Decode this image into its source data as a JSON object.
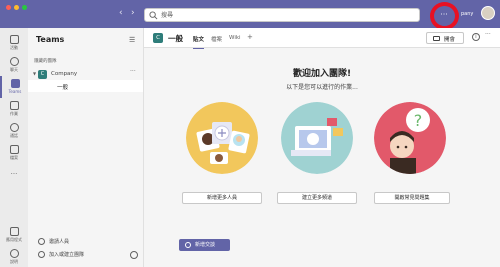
{
  "search": {
    "placeholder": "搜尋"
  },
  "titlebar": {
    "more_label": "···",
    "org_name": "pany"
  },
  "rail": {
    "items": [
      {
        "label": "活動",
        "icon": "bell-icon"
      },
      {
        "label": "聊天",
        "icon": "chat-icon"
      },
      {
        "label": "Teams",
        "icon": "teams-icon"
      },
      {
        "label": "作業",
        "icon": "assignments-icon"
      },
      {
        "label": "通話",
        "icon": "calls-icon"
      },
      {
        "label": "檔案",
        "icon": "files-icon"
      },
      {
        "label": "...",
        "icon": "more-apps-icon"
      }
    ],
    "apps_label": "應用程式",
    "help_label": "說明"
  },
  "sidebar": {
    "title": "Teams",
    "hidden_teams_label": "隱藏的團隊",
    "team": {
      "initial": "C",
      "name": "Company",
      "more": "···"
    },
    "channel": {
      "name": "一般"
    },
    "footer": {
      "invite_label": "邀請人員",
      "join_label": "加入或建立團隊"
    }
  },
  "channel": {
    "initial": "C",
    "name": "一般",
    "tabs": [
      "貼文",
      "檔案",
      "Wiki"
    ],
    "add_tab": "+",
    "meet_label": "開會",
    "info": "i",
    "more": "···"
  },
  "welcome": {
    "title": "歡迎加入團隊!",
    "subtitle": "以下是您可以進行的作業...",
    "actions": [
      "新增更多人員",
      "建立更多頻道",
      "開啟常見問題集"
    ]
  },
  "new_post_label": "新增交談",
  "colors": {
    "brand": "#6264a7",
    "callout": "#e81123"
  }
}
